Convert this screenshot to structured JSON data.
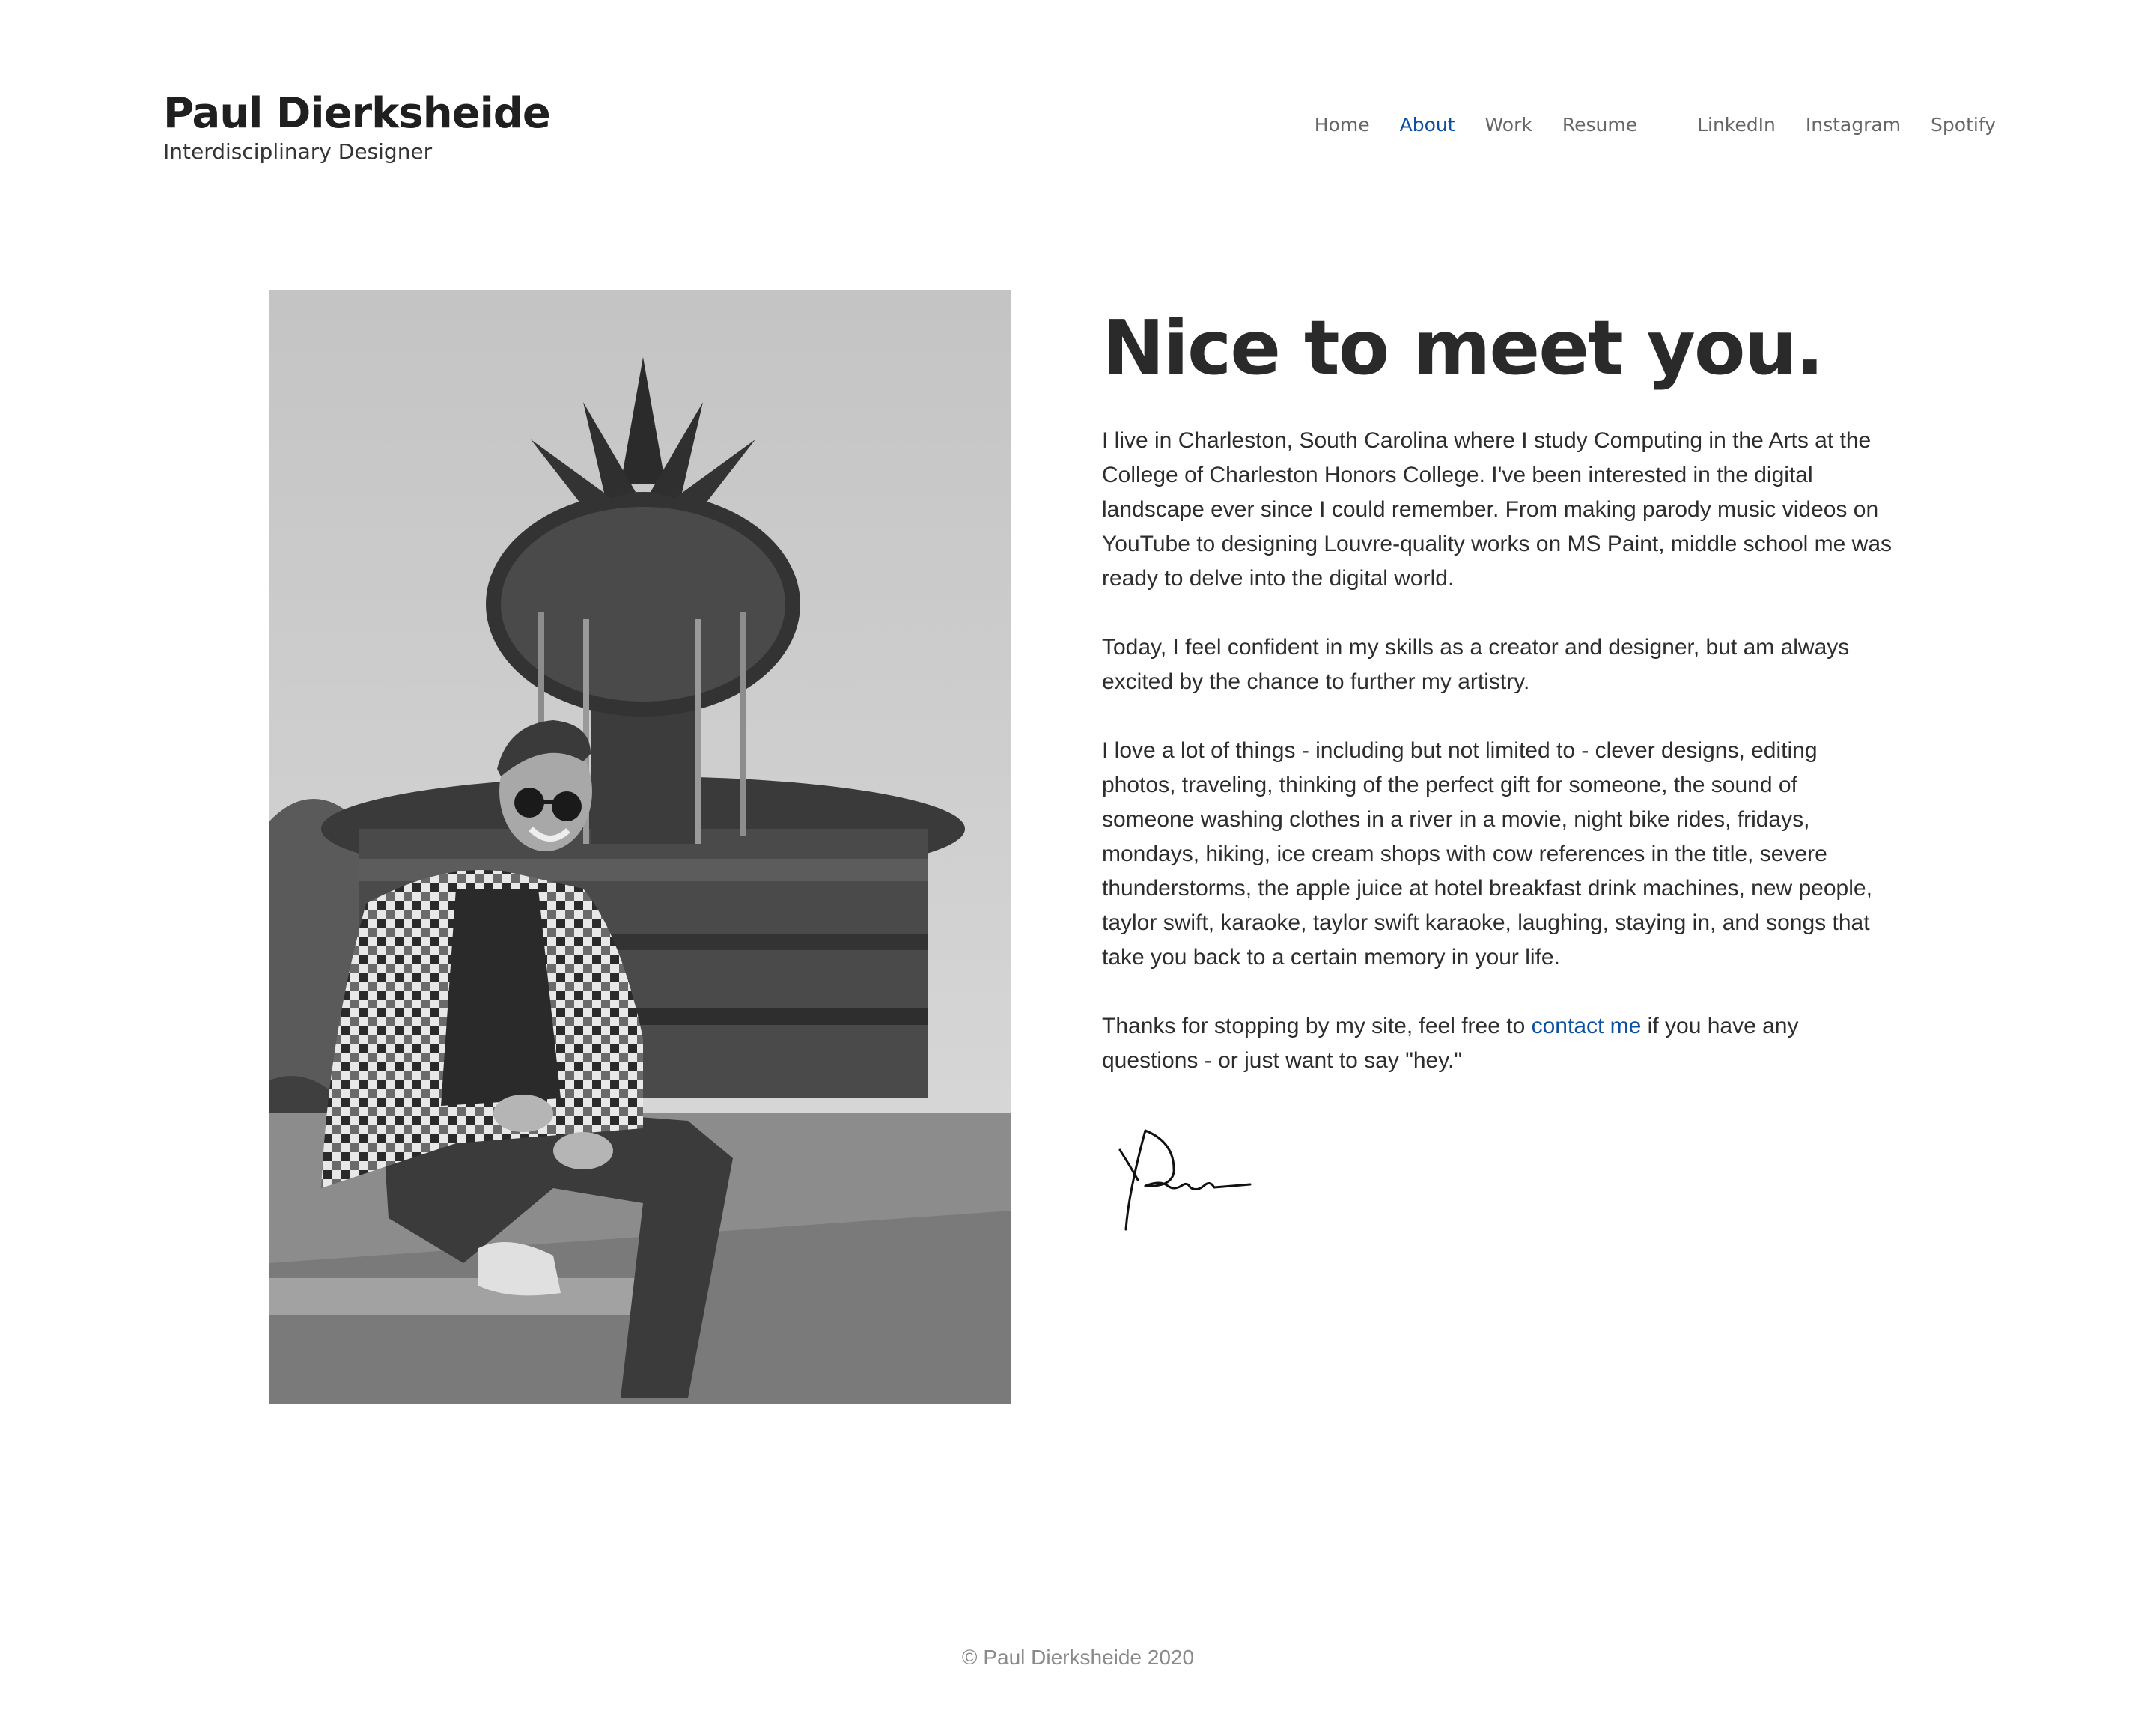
{
  "header": {
    "name": "Paul Dierksheide",
    "tagline": "Interdisciplinary Designer"
  },
  "nav": {
    "primary": [
      "Home",
      "About",
      "Work",
      "Resume"
    ],
    "social": [
      "LinkedIn",
      "Instagram",
      "Spotify"
    ],
    "active": "About",
    "active_color": "#0a4fa0"
  },
  "photo": {
    "description_icon": "portrait-photo"
  },
  "content": {
    "headline": "Nice to meet you.",
    "paragraph1": "I live in Charleston, South Carolina where I study Computing in the Arts at the College of Charleston Honors College. I've been interested in the digital landscape ever since I could remember. From making parody music videos on YouTube to designing Louvre-quality works on MS Paint, middle school me was ready to delve into the digital world.",
    "paragraph2": "Today, I feel confident in my skills as a creator and designer, but am always excited by the chance to further my artistry.",
    "paragraph3": "I love a lot of things - including but not limited to - clever designs, editing photos, traveling, thinking of the perfect gift for someone, the sound of someone washing clothes in a river in a movie, night bike rides, fridays, mondays, hiking, ice cream shops with cow references in the title, severe thunderstorms, the apple juice at hotel breakfast drink machines, new people, taylor swift, karaoke, taylor swift karaoke, laughing, staying in, and songs that take you back to a certain memory in your life.",
    "paragraph4_before": "Thanks for stopping by my site, feel free to ",
    "paragraph4_link": "contact me",
    "paragraph4_after": " if you have any questions - or just want to say \"hey.\"",
    "link_color": "#0a4fa0"
  },
  "footer": {
    "text": "© Paul Dierksheide 2020"
  }
}
